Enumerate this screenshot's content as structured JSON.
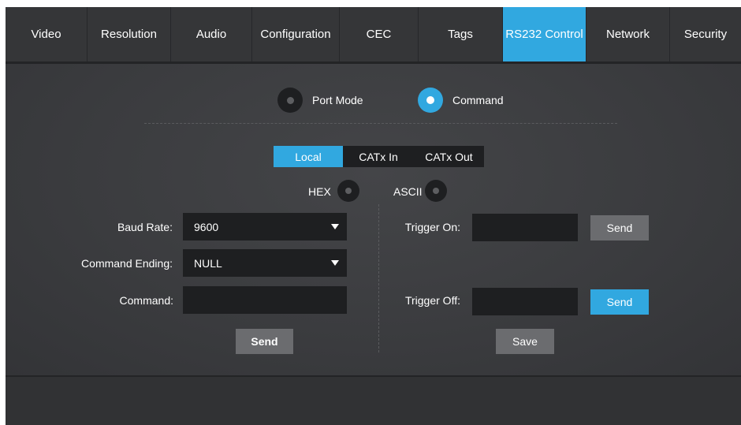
{
  "tabs": [
    {
      "label": "Video"
    },
    {
      "label": "Resolution"
    },
    {
      "label": "Audio"
    },
    {
      "label": "Configuration"
    },
    {
      "label": "CEC"
    },
    {
      "label": "Tags"
    },
    {
      "label": "RS232 Control",
      "active": true
    },
    {
      "label": "Network"
    },
    {
      "label": "Security"
    }
  ],
  "mode": {
    "port_mode_label": "Port Mode",
    "command_label": "Command",
    "selected": "Command"
  },
  "source_tabs": {
    "local": "Local",
    "catx_in": "CATx In",
    "catx_out": "CATx Out",
    "selected": "Local"
  },
  "format": {
    "hex_label": "HEX",
    "ascii_label": "ASCII"
  },
  "form": {
    "baud_rate_label": "Baud Rate:",
    "baud_rate_value": "9600",
    "command_ending_label": "Command Ending:",
    "command_ending_value": "NULL",
    "command_label": "Command:",
    "command_value": "",
    "send_label": "Send"
  },
  "trigger": {
    "on_label": "Trigger On:",
    "on_value": "",
    "on_send_label": "Send",
    "off_label": "Trigger Off:",
    "off_value": "",
    "off_send_label": "Send",
    "save_label": "Save"
  },
  "colors": {
    "accent": "#31a8e0",
    "background": "#2f3032",
    "field": "#1e1f21",
    "button": "#6b6c6f"
  }
}
